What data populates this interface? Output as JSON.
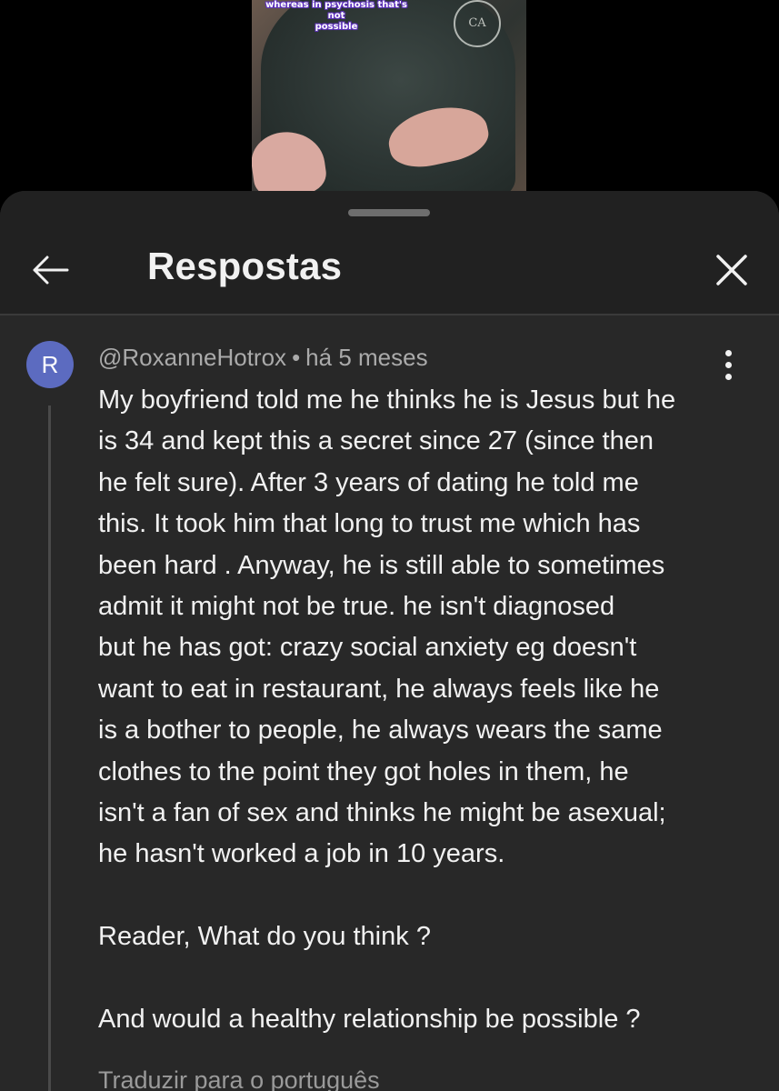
{
  "video": {
    "caption_lines": [
      "whereas in psychosis that's not",
      "possible"
    ],
    "logo_text": "CA"
  },
  "header": {
    "title": "Respostas",
    "back_icon": "arrow-left-icon",
    "close_icon": "close-icon"
  },
  "comment": {
    "avatar_letter": "R",
    "avatar_color": "#5c6bc0",
    "author": "@RoxanneHotrox",
    "separator": "•",
    "time": "há 5 meses",
    "menu_icon": "more-vert-icon",
    "lines": [
      "My boyfriend told me he thinks he is Jesus but he",
      "is 34 and kept this a secret since 27 (since then",
      "he felt sure). After 3 years of dating he told me",
      "this. It took him that long to trust me which has",
      "been hard . Anyway, he is still able to sometimes",
      "admit it might not be true. he isn't diagnosed",
      "but he has got: crazy social anxiety eg doesn't",
      "want to eat in restaurant, he always feels like he",
      "is a bother to people, he always wears the same",
      "clothes to the point they got holes in them, he",
      "isn't a fan of sex and thinks he might be asexual;",
      "he hasn't worked a job in 10 years.",
      "Reader, What do you think ?",
      "And would a healthy relationship be possible ?"
    ],
    "translate_label": "Traduzir para o português"
  }
}
